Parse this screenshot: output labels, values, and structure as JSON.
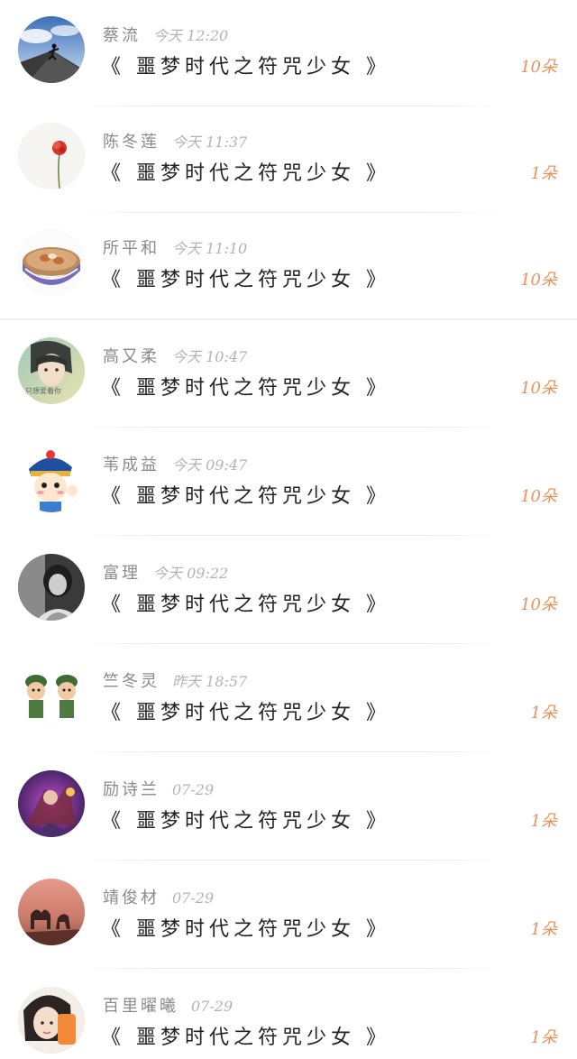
{
  "items": [
    {
      "name": "蔡流",
      "time": "今天 12:20",
      "title": "《 噩梦时代之符咒少女 》",
      "count": "10朵",
      "avatar": "mountain-climber-avatar"
    },
    {
      "name": "陈冬莲",
      "time": "今天 11:37",
      "title": "《 噩梦时代之符咒少女 》",
      "count": "1朵",
      "avatar": "red-flower-avatar"
    },
    {
      "name": "所平和",
      "time": "今天 11:10",
      "title": "《 噩梦时代之符咒少女 》",
      "count": "10朵",
      "avatar": "bowl-avatar"
    },
    {
      "name": "高又柔",
      "time": "今天 10:47",
      "title": "《 噩梦时代之符咒少女 》",
      "count": "10朵",
      "avatar": "girl-photo-avatar",
      "avatar_text": "只想爱着你"
    },
    {
      "name": "苇成益",
      "time": "今天 09:47",
      "title": "《 噩梦时代之符咒少女 》",
      "count": "10朵",
      "avatar": "cartoon-boy-avatar"
    },
    {
      "name": "富理",
      "time": "今天 09:22",
      "title": "《 噩梦时代之符咒少女 》",
      "count": "10朵",
      "avatar": "bw-portrait-avatar"
    },
    {
      "name": "竺冬灵",
      "time": "昨天 18:57",
      "title": "《 噩梦时代之符咒少女 》",
      "count": "1朵",
      "avatar": "soldier-dolls-avatar"
    },
    {
      "name": "励诗兰",
      "time": "07-29",
      "title": "《 噩梦时代之符咒少女 》",
      "count": "1朵",
      "avatar": "game-art-avatar"
    },
    {
      "name": "靖俊材",
      "time": "07-29",
      "title": "《 噩梦时代之符咒少女 》",
      "count": "1朵",
      "avatar": "sunset-camel-avatar"
    },
    {
      "name": "百里曜曦",
      "time": "07-29",
      "title": "《 噩梦时代之符咒少女 》",
      "count": "1朵",
      "avatar": "girl-selfie-avatar"
    }
  ],
  "colors": {
    "count": "#e8935a",
    "name": "#8a8a8a",
    "time": "#b3b3b3",
    "title": "#222222"
  }
}
